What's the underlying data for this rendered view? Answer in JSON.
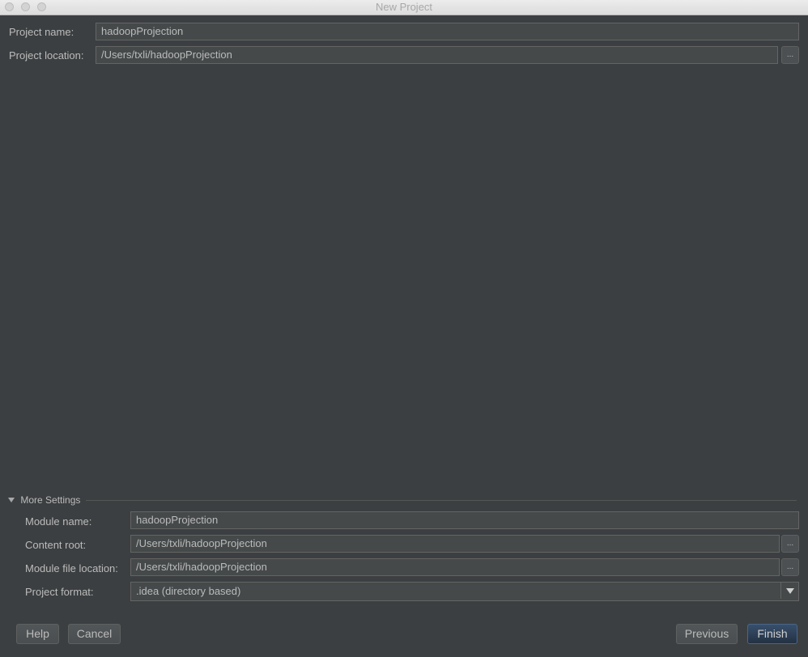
{
  "window": {
    "title": "New Project"
  },
  "project": {
    "name_label": "Project name:",
    "name_value": "hadoopProjection",
    "location_label": "Project location:",
    "location_value": "/Users/txli/hadoopProjection",
    "browse_label": "..."
  },
  "more_settings": {
    "title": "More Settings",
    "module_name_label": "Module name:",
    "module_name_value": "hadoopProjection",
    "content_root_label": "Content root:",
    "content_root_value": "/Users/txli/hadoopProjection",
    "module_file_location_label": "Module file location:",
    "module_file_location_value": "/Users/txli/hadoopProjection",
    "project_format_label": "Project format:",
    "project_format_value": ".idea (directory based)",
    "browse_label": "..."
  },
  "buttons": {
    "help": "Help",
    "cancel": "Cancel",
    "previous": "Previous",
    "finish": "Finish"
  },
  "colors": {
    "background": "#3c3f41",
    "field_background": "#45494a",
    "default_button": "#2b3e54"
  }
}
